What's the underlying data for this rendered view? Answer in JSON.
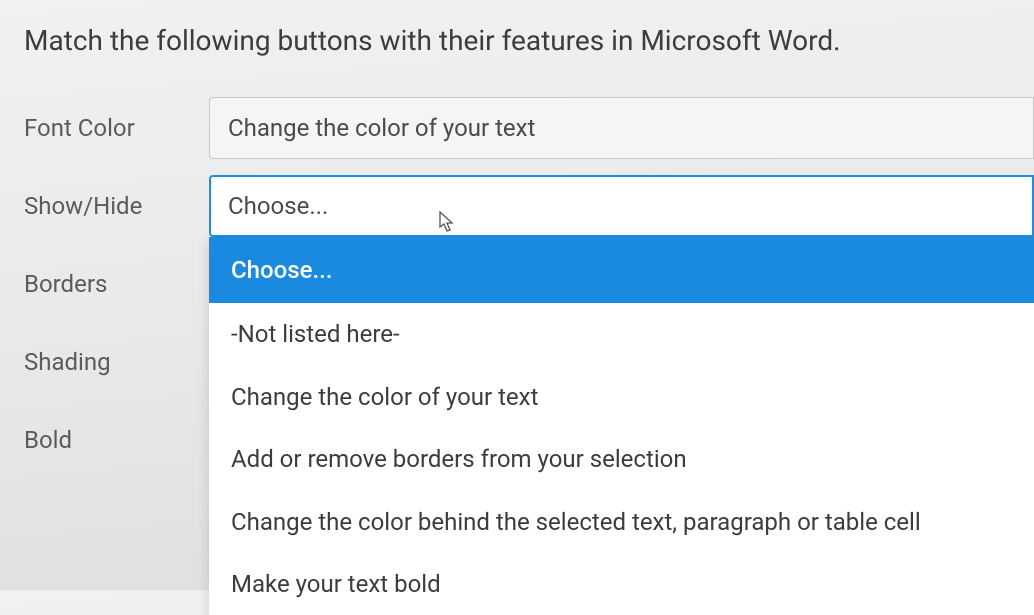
{
  "prompt": "Match the following buttons with their features in Microsoft Word.",
  "rows": [
    {
      "label": "Font Color",
      "selected": "Change the color of your text",
      "active": false
    },
    {
      "label": "Show/Hide",
      "selected": "Choose...",
      "active": true
    },
    {
      "label": "Borders",
      "selected": "",
      "active": false
    },
    {
      "label": "Shading",
      "selected": "",
      "active": false
    },
    {
      "label": "Bold",
      "selected": "",
      "active": false
    }
  ],
  "dropdown": {
    "options": [
      {
        "text": "Choose...",
        "highlighted": true
      },
      {
        "text": "-Not listed here-",
        "highlighted": false
      },
      {
        "text": "Change the color of your text",
        "highlighted": false
      },
      {
        "text": "Add or remove borders from your selection",
        "highlighted": false
      },
      {
        "text": "Change the color behind the selected text, paragraph or table cell",
        "highlighted": false
      },
      {
        "text": "Make your text bold",
        "highlighted": false
      }
    ]
  }
}
